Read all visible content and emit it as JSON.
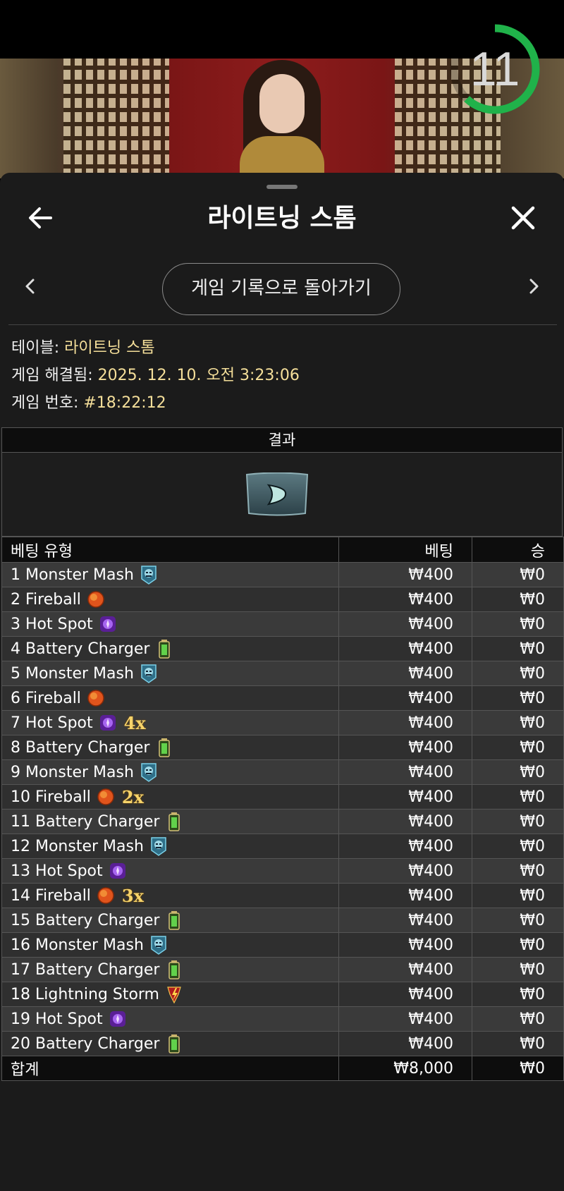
{
  "timer": {
    "seconds": "11",
    "progress": 0.62,
    "color": "#20b24a"
  },
  "header": {
    "title": "라이트닝 스톰",
    "back_icon": "arrow-left-icon",
    "close_icon": "close-icon"
  },
  "nav": {
    "back_history_label": "게임 기록으로 돌아가기"
  },
  "info": {
    "table_label": "테이블:",
    "table_value": "라이트닝 스톰",
    "resolved_label": "게임 해결됨:",
    "resolved_value": "2025. 12. 10. 오전 3:23:06",
    "game_no_label": "게임 번호:",
    "game_no_value": "#18:22:12",
    "value_color": "#f5df9a"
  },
  "result": {
    "header": "결과",
    "icon": "segment-result-icon"
  },
  "columns": {
    "type": "베팅 유형",
    "bet": "베팅",
    "win": "승"
  },
  "rows": [
    {
      "label": "1 Monster Mash",
      "icon": "monster",
      "mult": "",
      "bet": "₩400",
      "win": "₩0"
    },
    {
      "label": "2 Fireball",
      "icon": "fireball",
      "mult": "",
      "bet": "₩400",
      "win": "₩0"
    },
    {
      "label": "3 Hot Spot",
      "icon": "hotspot",
      "mult": "",
      "bet": "₩400",
      "win": "₩0"
    },
    {
      "label": "4 Battery Charger",
      "icon": "battery",
      "mult": "",
      "bet": "₩400",
      "win": "₩0"
    },
    {
      "label": "5 Monster Mash",
      "icon": "monster",
      "mult": "",
      "bet": "₩400",
      "win": "₩0"
    },
    {
      "label": "6 Fireball",
      "icon": "fireball",
      "mult": "",
      "bet": "₩400",
      "win": "₩0"
    },
    {
      "label": "7 Hot Spot",
      "icon": "hotspot",
      "mult": "4x",
      "bet": "₩400",
      "win": "₩0"
    },
    {
      "label": "8 Battery Charger",
      "icon": "battery",
      "mult": "",
      "bet": "₩400",
      "win": "₩0"
    },
    {
      "label": "9 Monster Mash",
      "icon": "monster",
      "mult": "",
      "bet": "₩400",
      "win": "₩0"
    },
    {
      "label": "10 Fireball",
      "icon": "fireball",
      "mult": "2x",
      "bet": "₩400",
      "win": "₩0"
    },
    {
      "label": "11 Battery Charger",
      "icon": "battery",
      "mult": "",
      "bet": "₩400",
      "win": "₩0"
    },
    {
      "label": "12 Monster Mash",
      "icon": "monster",
      "mult": "",
      "bet": "₩400",
      "win": "₩0"
    },
    {
      "label": "13 Hot Spot",
      "icon": "hotspot",
      "mult": "",
      "bet": "₩400",
      "win": "₩0"
    },
    {
      "label": "14 Fireball",
      "icon": "fireball",
      "mult": "3x",
      "bet": "₩400",
      "win": "₩0"
    },
    {
      "label": "15 Battery Charger",
      "icon": "battery",
      "mult": "",
      "bet": "₩400",
      "win": "₩0"
    },
    {
      "label": "16 Monster Mash",
      "icon": "monster",
      "mult": "",
      "bet": "₩400",
      "win": "₩0"
    },
    {
      "label": "17 Battery Charger",
      "icon": "battery",
      "mult": "",
      "bet": "₩400",
      "win": "₩0"
    },
    {
      "label": "18 Lightning Storm",
      "icon": "lightning",
      "mult": "",
      "bet": "₩400",
      "win": "₩0"
    },
    {
      "label": "19 Hot Spot",
      "icon": "hotspot",
      "mult": "",
      "bet": "₩400",
      "win": "₩0"
    },
    {
      "label": "20 Battery Charger",
      "icon": "battery",
      "mult": "",
      "bet": "₩400",
      "win": "₩0"
    }
  ],
  "total": {
    "label": "합계",
    "bet": "₩8,000",
    "win": "₩0"
  }
}
